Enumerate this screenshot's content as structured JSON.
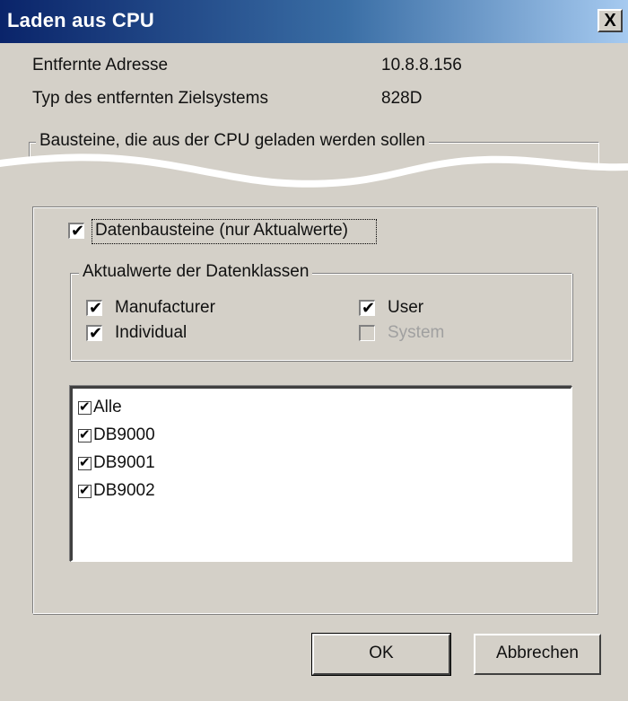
{
  "dialog": {
    "title": "Laden aus CPU",
    "close_label": "X"
  },
  "info": {
    "remote_address_label": "Entfernte Adresse",
    "remote_address_value": "10.8.8.156",
    "target_type_label": "Typ des entfernten Zielsystems",
    "target_type_value": "828D"
  },
  "blocks_group": {
    "title": "Bausteine, die aus der CPU geladen werden sollen"
  },
  "data_blocks": {
    "label": "Datenbausteine (nur Aktualwerte)",
    "checked": true
  },
  "classes_group": {
    "title": "Aktualwerte der Datenklassen",
    "items": [
      {
        "label": "Manufacturer",
        "checked": true,
        "enabled": true
      },
      {
        "label": "User",
        "checked": true,
        "enabled": true
      },
      {
        "label": "Individual",
        "checked": true,
        "enabled": true
      },
      {
        "label": "System",
        "checked": false,
        "enabled": false
      }
    ]
  },
  "block_list": {
    "items": [
      {
        "label": "Alle",
        "checked": true
      },
      {
        "label": "DB9000",
        "checked": true
      },
      {
        "label": "DB9001",
        "checked": true
      },
      {
        "label": "DB9002",
        "checked": true
      }
    ]
  },
  "buttons": {
    "ok_label": "OK",
    "cancel_label": "Abbrechen"
  },
  "icons": {
    "check": "✔",
    "close": "X"
  },
  "colors": {
    "titlebar_start": "#0a246a",
    "titlebar_end": "#a6caf0",
    "face": "#d4d0c8"
  }
}
